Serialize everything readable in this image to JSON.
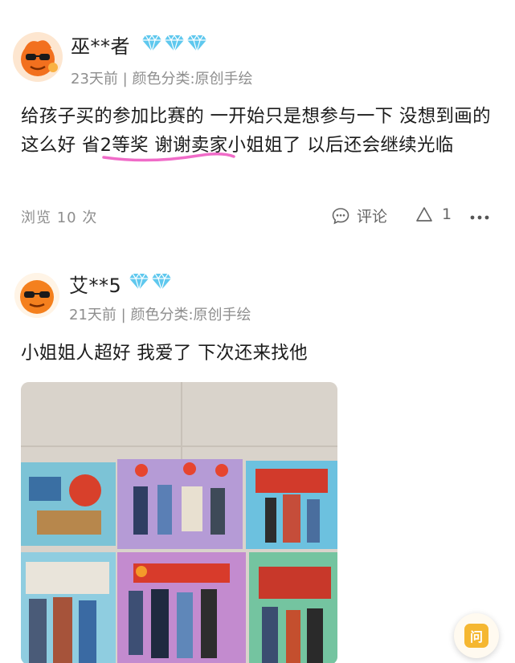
{
  "reviews": [
    {
      "username": "巫**者",
      "badge_count": 3,
      "date": "23天前",
      "separator": "|",
      "variant": "颜色分类:原创手绘",
      "text": "给孩子买的参加比赛的 一开始只是想参与一下 没想到画的这么好 省2等奖 谢谢卖家小姐姐了 以后还会继续光临",
      "views": "浏览 10 次",
      "comment_label": "评论",
      "like_count": "1",
      "avatar_icon": "sunglasses-emoji-avatar"
    },
    {
      "username": "艾**5",
      "badge_count": 2,
      "date": "21天前",
      "separator": "|",
      "variant": "颜色分类:原创手绘",
      "text": "小姐姐人超好 我爱了 下次还来找他",
      "avatar_icon": "sunglasses-emoji-avatar"
    }
  ],
  "float_button": {
    "label": "问"
  },
  "colors": {
    "diamond": "#5fc8ee",
    "highlight": "#f06bc8",
    "meta_gray": "#8e8e8e",
    "float_accent": "#f5b731"
  }
}
